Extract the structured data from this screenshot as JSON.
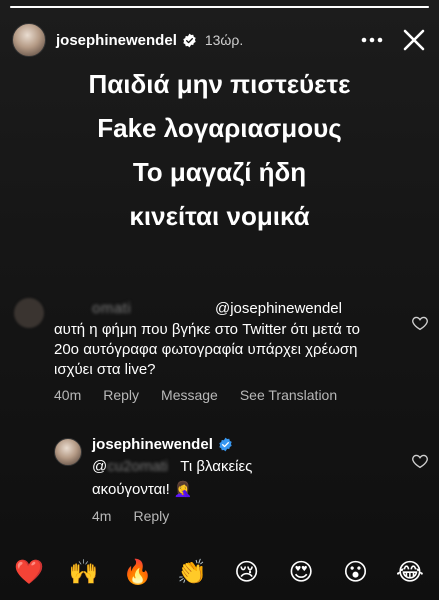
{
  "story": {
    "username": "josephinewendel",
    "time": "13ώρ.",
    "progress": 1.0,
    "headline": [
      "Παιδιά μην πιστεύετε",
      "Fake λογαριασμους",
      "Το μαγαζί ήδη",
      "κινείται νομικά"
    ]
  },
  "comment1": {
    "blurred_name": "omati",
    "mention": "@josephinewendel",
    "text": "αυτή η φήμη που βγήκε στο Twitter ότι μετά το 20ο αυτόγραφα φωτογραφία υπάρχει χρέωση ισχύει στα live?",
    "time": "40m",
    "reply": "Reply",
    "message": "Message",
    "translation": "See Translation"
  },
  "comment2": {
    "username": "josephinewendel",
    "mention_prefix": "@",
    "blurred_handle": "cu2omati",
    "text_line1": "Τι βλακείες",
    "text_line2": "ακούγονται! 🤦‍♀️",
    "time": "4m",
    "reply": "Reply"
  },
  "reactions": [
    "❤️",
    "🙌",
    "🔥",
    "👏",
    "😢",
    "😍",
    "😮",
    "😂"
  ],
  "colors": {
    "verified": "#3897f0",
    "background": "#161616"
  },
  "icons": [
    "verified-icon",
    "more-icon",
    "close-icon",
    "heart-icon"
  ]
}
